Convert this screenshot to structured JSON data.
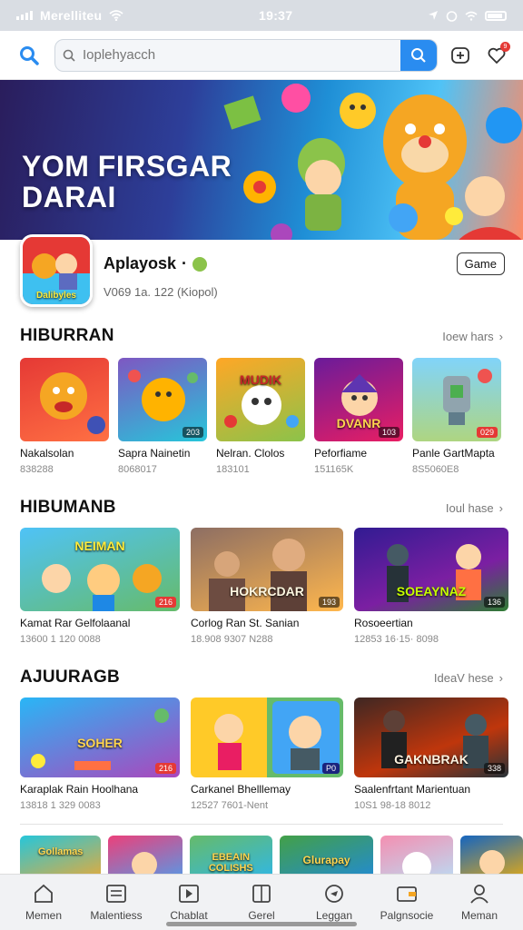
{
  "status": {
    "carrier": "Merelliteu",
    "time": "19:37"
  },
  "search": {
    "placeholder": "Ioplehyacch"
  },
  "notifications": {
    "count": "9"
  },
  "banner": {
    "title_line1": "YOM FIRSGAR",
    "title_line2": "DARAI"
  },
  "app": {
    "name": "Aplayosk",
    "meta": "V069 1a. 122 (Kiopol)",
    "button": "Game",
    "icon_label": "Dalibyles"
  },
  "sections": [
    {
      "title": "HIBURRAN",
      "more": "Ioew hars",
      "items": [
        {
          "name": "Nakalsolan",
          "meta": "838288",
          "label": "",
          "tag": ""
        },
        {
          "name": "Sapra Nainetin",
          "meta": "8068017",
          "label": "",
          "tag": "203"
        },
        {
          "name": "Nelran. Clolos",
          "meta": "183101",
          "label": "MUDIK",
          "tag": ""
        },
        {
          "name": "Peforfiame",
          "meta": "151165K",
          "label": "DVANR",
          "tag": "103"
        },
        {
          "name": "Panle GartMapta",
          "meta": "8S5060E8",
          "label": "",
          "tag": "029"
        }
      ]
    },
    {
      "title": "HIBUMANB",
      "more": "Ioul hase",
      "items": [
        {
          "name": "Kamat Rar Gelfolaanal",
          "meta": "13600 1 120 0088",
          "label": "NEIMAN",
          "tag": "216"
        },
        {
          "name": "Corlog Ran St. Sanian",
          "meta": "18.908 9307 N288",
          "label": "HOKRCDAR",
          "tag": "193"
        },
        {
          "name": "Rosoeertian",
          "meta": "12853 16·15· 8098",
          "label": "SOEAYNAZ",
          "tag": "136"
        }
      ]
    },
    {
      "title": "AJUURAGB",
      "more": "IdeaV hese",
      "items": [
        {
          "name": "Karaplak Rain Hoolhana",
          "meta": "13818 1 329 0083",
          "label": "SOHER",
          "tag": "216"
        },
        {
          "name": "Carkanel Bhelllemay",
          "meta": "12527 7601-Nent",
          "label": "",
          "tag": "P0"
        },
        {
          "name": "Saalenfrtant Marientuan",
          "meta": "10S1 98-18 8012",
          "label": "GAKNBRAK",
          "tag": "338"
        }
      ]
    }
  ],
  "bottom_row": [
    {
      "label": "Gollamas"
    },
    {
      "label": ""
    },
    {
      "label": "EBEAIN COLISHS"
    },
    {
      "label": "Glurapay"
    },
    {
      "label": ""
    },
    {
      "label": ""
    }
  ],
  "tabs": [
    {
      "label": "Memen",
      "icon": "home-icon"
    },
    {
      "label": "Malentiess",
      "icon": "list-icon"
    },
    {
      "label": "Chablat",
      "icon": "play-icon"
    },
    {
      "label": "Gerel",
      "icon": "book-icon"
    },
    {
      "label": "Leggan",
      "icon": "compass-icon"
    },
    {
      "label": "Palgnsocie",
      "icon": "wallet-icon"
    },
    {
      "label": "Meman",
      "icon": "profile-icon"
    }
  ],
  "colors": {
    "accent": "#2a8cf0",
    "badge": "#e53935"
  }
}
